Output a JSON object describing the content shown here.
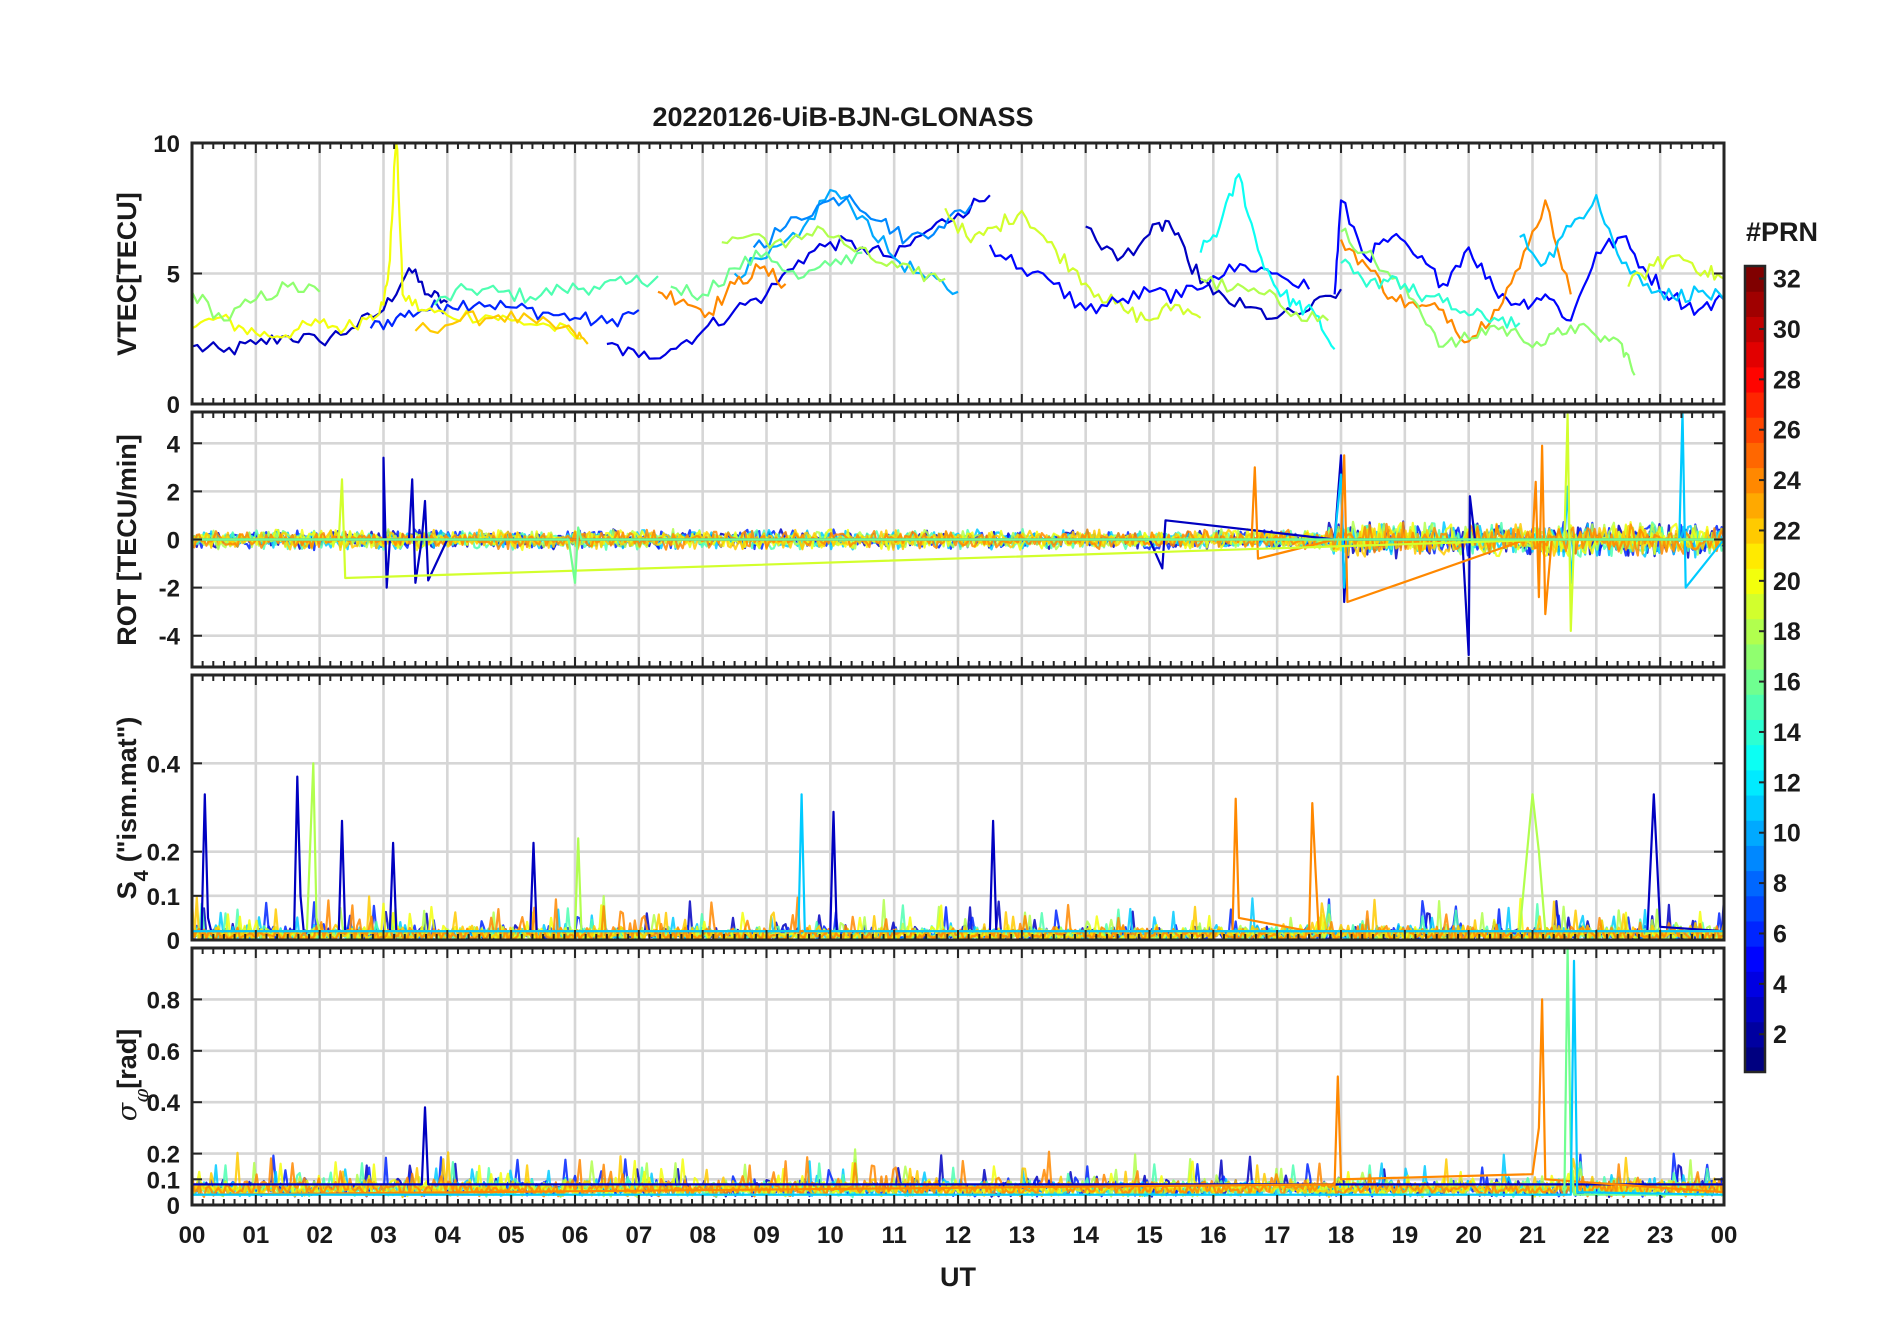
{
  "figure_title": "20220126-UiB-BJN-GLONASS",
  "colorbar": {
    "label": "#PRN",
    "range": [
      1,
      32
    ],
    "tick_labels": [
      "2",
      "4",
      "6",
      "8",
      "10",
      "12",
      "14",
      "16",
      "18",
      "20",
      "22",
      "24",
      "26",
      "28",
      "30",
      "32"
    ],
    "colormap": "jet"
  },
  "chart_data": [
    {
      "type": "line",
      "ylabel": "VTEC[TECU]",
      "xlabel": "",
      "xlim": [
        0,
        24
      ],
      "ylim": [
        0,
        10
      ],
      "yticks": [
        0,
        5,
        10
      ],
      "ytick_labels": [
        "0",
        "5",
        "10"
      ],
      "grid": true,
      "series": [
        {
          "prn": 3,
          "x": [
            0,
            0.5,
            1,
            1.5,
            2,
            2.5,
            3,
            3.4,
            3.7,
            4
          ],
          "y": [
            2.2,
            2.0,
            2.3,
            2.6,
            2.4,
            2.9,
            3.6,
            5.2,
            4.2,
            3.9
          ]
        },
        {
          "prn": 6,
          "x": [
            2.8,
            3.2,
            3.6,
            4,
            4.5,
            5,
            5.5,
            6,
            6.5,
            7
          ],
          "y": [
            2.9,
            3.3,
            3.6,
            3.8,
            3.9,
            3.7,
            3.5,
            3.3,
            3.1,
            3.6
          ]
        },
        {
          "prn": 15,
          "x": [
            3.8,
            4.3,
            4.8,
            5.3,
            5.8,
            6.3,
            6.8,
            7.3
          ],
          "y": [
            3.8,
            4.4,
            4.3,
            4.1,
            4.4,
            4.5,
            4.6,
            4.9
          ]
        },
        {
          "prn": 20,
          "x": [
            0,
            0.4,
            0.8,
            1.2,
            1.6,
            2,
            2.4,
            2.8,
            3.0,
            3.1,
            3.2,
            3.3,
            3.6,
            4,
            4.6,
            5,
            5.6,
            6.1
          ],
          "y": [
            2.9,
            3.3,
            2.9,
            2.6,
            2.8,
            3.1,
            2.9,
            3.4,
            3.8,
            5.5,
            10.5,
            4.2,
            3.6,
            3.4,
            3.4,
            3.2,
            3.0,
            2.5
          ]
        },
        {
          "prn": 22,
          "x": [
            3.5,
            4.2,
            4.8,
            5.4,
            6.0,
            6.2
          ],
          "y": [
            2.8,
            3.2,
            3.4,
            3.1,
            2.7,
            2.3
          ]
        },
        {
          "prn": 17,
          "x": [
            0,
            0.5,
            1,
            1.5,
            2
          ],
          "y": [
            4.3,
            3.2,
            4.0,
            4.5,
            4.3
          ]
        },
        {
          "prn": 4,
          "x": [
            6.5,
            7,
            7.5,
            8,
            8.5,
            9,
            9.5,
            10,
            10.5,
            11,
            11.5,
            12,
            12.5
          ],
          "y": [
            2.3,
            1.8,
            2.1,
            2.8,
            3.6,
            4.2,
            5.5,
            6.2,
            6.0,
            5.6,
            6.6,
            7.3,
            8.0
          ]
        },
        {
          "prn": 10,
          "x": [
            8.5,
            9,
            9.5,
            10,
            10.5,
            11,
            11.5,
            12
          ],
          "y": [
            5.0,
            5.6,
            6.4,
            8.2,
            7.2,
            5.6,
            4.8,
            4.3
          ]
        },
        {
          "prn": 9,
          "x": [
            8.8,
            9.3,
            9.8,
            10.3,
            10.8,
            11.2,
            11.7,
            12.2
          ],
          "y": [
            6.0,
            6.8,
            7.6,
            8.0,
            7.0,
            6.3,
            6.8,
            7.6
          ]
        },
        {
          "prn": 24,
          "x": [
            7.3,
            7.7,
            8.1,
            8.5,
            8.9,
            9.3
          ],
          "y": [
            4.3,
            4.0,
            3.5,
            4.6,
            5.2,
            4.6
          ]
        },
        {
          "prn": 18,
          "x": [
            8.3,
            8.8,
            9.3,
            9.8,
            10.3,
            10.8,
            11.3,
            11.8
          ],
          "y": [
            6.2,
            6.5,
            6.0,
            6.8,
            6.0,
            5.4,
            5.0,
            4.8
          ]
        },
        {
          "prn": 16,
          "x": [
            7.5,
            8,
            8.5,
            9,
            9.5,
            10,
            10.5
          ],
          "y": [
            4.5,
            4.2,
            5.2,
            5.8,
            4.8,
            5.3,
            5.8
          ]
        },
        {
          "prn": 19,
          "x": [
            11.8,
            12.2,
            12.6,
            13,
            13.4,
            13.8,
            14.2,
            14.6,
            15,
            15.4,
            15.8
          ],
          "y": [
            7.5,
            6.2,
            6.8,
            7.4,
            6.2,
            5.2,
            4.2,
            3.6,
            3.2,
            3.8,
            3.3
          ]
        },
        {
          "prn": 5,
          "x": [
            12.5,
            13,
            13.5,
            14,
            14.5,
            15,
            15.5,
            16,
            16.5,
            17,
            17.5
          ],
          "y": [
            6.1,
            5.2,
            4.6,
            3.6,
            3.9,
            4.3,
            4.1,
            4.9,
            5.3,
            5.0,
            4.4
          ]
        },
        {
          "prn": 3,
          "x": [
            14,
            14.5,
            15,
            15.3,
            15.6,
            16,
            16.5,
            17,
            17.5,
            18
          ],
          "y": [
            6.8,
            5.5,
            6.5,
            7.0,
            5.5,
            4.2,
            3.7,
            3.3,
            3.6,
            4.4
          ]
        },
        {
          "prn": 13,
          "x": [
            15.8,
            16.1,
            16.4,
            16.7,
            17,
            17.3,
            17.6,
            17.9
          ],
          "y": [
            5.8,
            6.8,
            8.8,
            5.9,
            4.4,
            3.8,
            3.4,
            2.1
          ]
        },
        {
          "prn": 18,
          "x": [
            15.8,
            16.3,
            16.8,
            17.3,
            17.8
          ],
          "y": [
            4.8,
            4.4,
            4.2,
            3.5,
            3.2
          ]
        },
        {
          "prn": 5,
          "x": [
            17.9,
            18.0,
            18.4,
            18.8,
            19.2,
            19.6,
            20,
            20.4,
            20.8,
            21.2,
            21.6,
            22,
            22.4,
            22.8,
            23.2,
            23.6,
            24
          ],
          "y": [
            4.2,
            7.8,
            5.6,
            6.4,
            5.6,
            4.6,
            6.0,
            4.4,
            3.8,
            4.2,
            3.2,
            5.8,
            6.4,
            5.0,
            4.1,
            3.6,
            4.0
          ]
        },
        {
          "prn": 24,
          "x": [
            18,
            18.4,
            18.8,
            19.2,
            19.6,
            20,
            20.4,
            20.8,
            21.2,
            21.6
          ],
          "y": [
            6.3,
            5.3,
            4.1,
            3.7,
            3.6,
            2.4,
            3.6,
            5.2,
            7.8,
            4.2
          ]
        },
        {
          "prn": 17,
          "x": [
            18,
            18.4,
            18.8,
            19.2,
            19.6,
            20,
            20.4,
            20.8,
            21.2,
            21.6,
            22,
            22.4,
            22.6
          ],
          "y": [
            6.6,
            5.8,
            4.8,
            3.8,
            2.2,
            2.5,
            3.0,
            2.6,
            2.3,
            3.0,
            2.6,
            2.3,
            1.1
          ]
        },
        {
          "prn": 11,
          "x": [
            20.8,
            21.2,
            21.6,
            22,
            22.4,
            22.8,
            23.2,
            23.6,
            24
          ],
          "y": [
            6.4,
            5.4,
            6.8,
            8.0,
            5.4,
            4.6,
            4.1,
            4.3,
            4.0
          ]
        },
        {
          "prn": 14,
          "x": [
            18,
            18.4,
            18.8,
            19.2,
            19.6,
            20,
            20.4,
            20.8
          ],
          "y": [
            5.4,
            4.5,
            4.9,
            4.2,
            3.9,
            3.4,
            3.3,
            3.1
          ]
        },
        {
          "prn": 19,
          "x": [
            22.5,
            22.9,
            23.3,
            23.7,
            24
          ],
          "y": [
            4.5,
            5.3,
            5.7,
            5.1,
            4.8
          ]
        }
      ]
    },
    {
      "type": "line",
      "ylabel": "ROT [TECU/min]",
      "xlabel": "",
      "xlim": [
        0,
        24
      ],
      "ylim": [
        -5.3,
        5.3
      ],
      "yticks": [
        -4,
        -2,
        0,
        2,
        4
      ],
      "ytick_labels": [
        "-4",
        "-2",
        "0",
        "2",
        "4"
      ],
      "grid": true,
      "series": [
        {
          "prn": 3,
          "x": [
            0,
            3.0,
            3.0,
            3.05,
            3.1,
            3.4,
            3.45,
            3.5,
            3.6,
            3.65,
            3.7,
            4,
            9,
            10,
            15,
            15.2,
            15.25,
            17.9,
            18.0,
            18.05,
            18.1,
            19.9,
            20.0,
            20.02,
            20.1,
            24
          ],
          "y": [
            0,
            0,
            3.4,
            -2.0,
            0,
            0,
            2.5,
            -1.8,
            0,
            1.6,
            -1.7,
            0,
            0,
            0,
            0,
            -1.2,
            0.8,
            0,
            3.5,
            -2.6,
            0,
            0,
            -4.8,
            1.8,
            0,
            0
          ]
        },
        {
          "prn": 11,
          "x": [
            0,
            17.9,
            18,
            18.05,
            18.1,
            21.5,
            21.55,
            21.6,
            21.65,
            23.3,
            23.35,
            23.4,
            24
          ],
          "y": [
            0,
            0,
            2.7,
            -2.0,
            0,
            0,
            2.2,
            -1.8,
            0,
            0,
            5.3,
            -2.0,
            0
          ]
        },
        {
          "prn": 24,
          "x": [
            0,
            16.6,
            16.65,
            16.7,
            17.9,
            18,
            18.05,
            18.1,
            20.9,
            21.0,
            21.05,
            21.1,
            21.15,
            21.2,
            21.3,
            24
          ],
          "y": [
            0,
            0,
            3.0,
            -0.8,
            0,
            0,
            3.5,
            -2.6,
            0,
            0,
            2.4,
            -2.4,
            3.9,
            -3.1,
            0,
            0
          ]
        },
        {
          "prn": 19,
          "x": [
            0,
            2.3,
            2.35,
            2.4,
            21.3,
            21.5,
            21.55,
            21.6,
            21.65,
            24
          ],
          "y": [
            0,
            0,
            2.5,
            -1.6,
            0,
            0,
            5.2,
            -3.8,
            0,
            0
          ]
        },
        {
          "prn": 16,
          "x": [
            0,
            5.9,
            6.0,
            6.05,
            6.1,
            24
          ],
          "y": [
            0,
            0,
            -1.8,
            0.5,
            0,
            0
          ]
        }
      ],
      "noise_band": 0.45
    },
    {
      "type": "line",
      "ylabel": "S4 (\"ism.mat\")",
      "ylabel_main": "S",
      "ylabel_sub": "4",
      "ylabel_rest": "(\"ism.mat\")",
      "xlabel": "",
      "xlim": [
        0,
        24
      ],
      "ylim": [
        0,
        0.6
      ],
      "yticks": [
        0,
        0.1,
        0.2,
        0.4
      ],
      "ytick_labels": [
        "0",
        "0.1",
        "0.2",
        "0.4"
      ],
      "grid": true,
      "series": [
        {
          "prn": 3,
          "x": [
            0,
            0.15,
            0.2,
            0.25,
            0.3,
            1.6,
            1.65,
            1.7,
            1.75,
            2.0,
            2.3,
            2.35,
            2.4,
            3.1,
            3.15,
            3.2,
            5.3,
            5.35,
            5.4,
            10.0,
            10.05,
            10.1,
            12.5,
            12.55,
            12.6,
            22.8,
            22.9,
            22.95,
            23.0,
            24
          ],
          "y": [
            0.02,
            0.02,
            0.33,
            0.05,
            0.02,
            0.02,
            0.37,
            0.1,
            0.02,
            0.02,
            0.02,
            0.27,
            0.02,
            0.02,
            0.22,
            0.02,
            0.02,
            0.22,
            0.02,
            0.02,
            0.29,
            0.02,
            0.02,
            0.27,
            0.02,
            0.02,
            0.33,
            0.18,
            0.03,
            0.02
          ]
        },
        {
          "prn": 18,
          "x": [
            0,
            1.8,
            1.9,
            1.95,
            2.0,
            6.0,
            6.05,
            6.1,
            19.8,
            20.8,
            21.0,
            21.1,
            21.2,
            24
          ],
          "y": [
            0.02,
            0.02,
            0.4,
            0.05,
            0.02,
            0.02,
            0.23,
            0.02,
            0.02,
            0.02,
            0.33,
            0.2,
            0.02,
            0.02
          ]
        },
        {
          "prn": 24,
          "x": [
            0,
            16.3,
            16.35,
            16.4,
            17.5,
            17.55,
            17.6,
            17.65,
            24
          ],
          "y": [
            0.02,
            0.02,
            0.32,
            0.05,
            0.02,
            0.31,
            0.16,
            0.02,
            0.02
          ]
        },
        {
          "prn": 11,
          "x": [
            0,
            9.5,
            9.55,
            9.6,
            24
          ],
          "y": [
            0.02,
            0.02,
            0.33,
            0.02,
            0.02
          ]
        }
      ],
      "noise_band": 0.05
    },
    {
      "type": "line",
      "ylabel": "σφ[rad]",
      "ylabel_main": "σ",
      "ylabel_sub": "φ",
      "ylabel_rest": "[rad]",
      "xlabel": "UT",
      "xlim": [
        0,
        24
      ],
      "ylim": [
        0,
        1.0
      ],
      "yticks": [
        0,
        0.1,
        0.2,
        0.4,
        0.6,
        0.8
      ],
      "ytick_labels": [
        "0",
        "0.1",
        "0.2",
        "0.4",
        "0.6",
        "0.8"
      ],
      "xtick_labels": [
        "00",
        "01",
        "02",
        "03",
        "04",
        "05",
        "06",
        "07",
        "08",
        "09",
        "10",
        "11",
        "12",
        "13",
        "14",
        "15",
        "16",
        "17",
        "18",
        "19",
        "20",
        "21",
        "22",
        "23",
        "00"
      ],
      "grid": true,
      "series": [
        {
          "prn": 3,
          "x": [
            0,
            3.6,
            3.65,
            3.7,
            24
          ],
          "y": [
            0.08,
            0.08,
            0.38,
            0.08,
            0.08
          ]
        },
        {
          "prn": 24,
          "x": [
            0,
            17.9,
            17.95,
            18.0,
            21.0,
            21.1,
            21.15,
            21.2,
            24
          ],
          "y": [
            0.04,
            0.08,
            0.5,
            0.1,
            0.12,
            0.3,
            0.8,
            0.1,
            0.05
          ]
        },
        {
          "prn": 16,
          "x": [
            0,
            21.5,
            21.55,
            21.6,
            21.65,
            24
          ],
          "y": [
            0.04,
            0.04,
            1.0,
            0.2,
            0.04,
            0.04
          ]
        },
        {
          "prn": 11,
          "x": [
            0,
            21.6,
            21.65,
            21.7,
            24
          ],
          "y": [
            0.04,
            0.04,
            0.95,
            0.05,
            0.04
          ]
        }
      ],
      "noise_band": 0.08
    }
  ]
}
